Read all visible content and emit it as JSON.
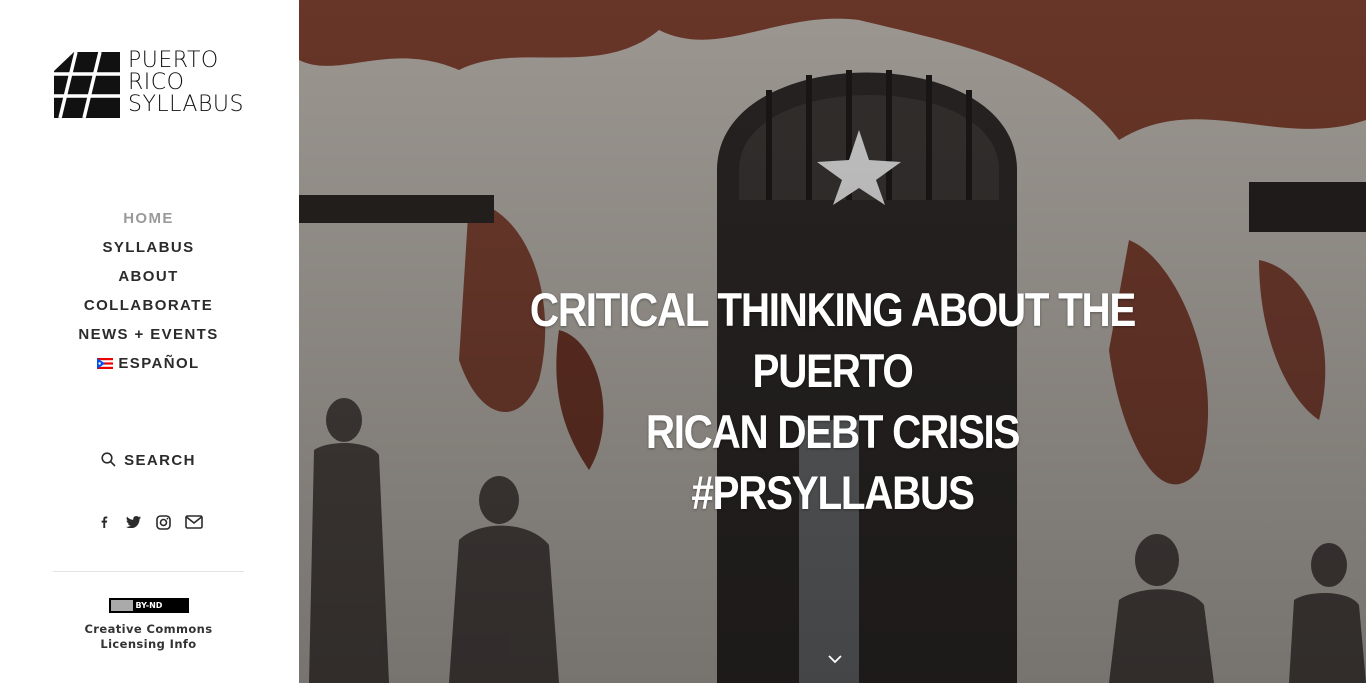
{
  "brand": {
    "name_lines": [
      "PUERTO",
      "RICO",
      "SYLLABUS"
    ]
  },
  "nav": {
    "items": [
      {
        "label": "HOME",
        "active": true
      },
      {
        "label": "SYLLABUS",
        "active": false
      },
      {
        "label": "ABOUT",
        "active": false
      },
      {
        "label": "COLLABORATE",
        "active": false
      },
      {
        "label": "NEWS + EVENTS",
        "active": false
      },
      {
        "label": "ESPAÑOL",
        "active": false,
        "icon": "puerto-rico-flag-icon"
      }
    ]
  },
  "search": {
    "label": "SEARCH",
    "icon": "search-icon"
  },
  "social": {
    "icons": [
      "facebook-icon",
      "twitter-icon",
      "instagram-icon",
      "email-icon"
    ]
  },
  "license": {
    "badge_text": "BY-ND",
    "label_line1": "Creative Commons",
    "label_line2": "Licensing Info"
  },
  "hero": {
    "title_lines": [
      "CRITICAL THINKING ABOUT THE PUERTO",
      "RICAN DEBT CRISIS",
      "#PRSYLLABUS"
    ],
    "scroll_icon": "chevron-down-icon"
  },
  "colors": {
    "nav_text": "#2b2b2b",
    "nav_active": "#9a9a9a",
    "hero_text": "#ffffff"
  }
}
